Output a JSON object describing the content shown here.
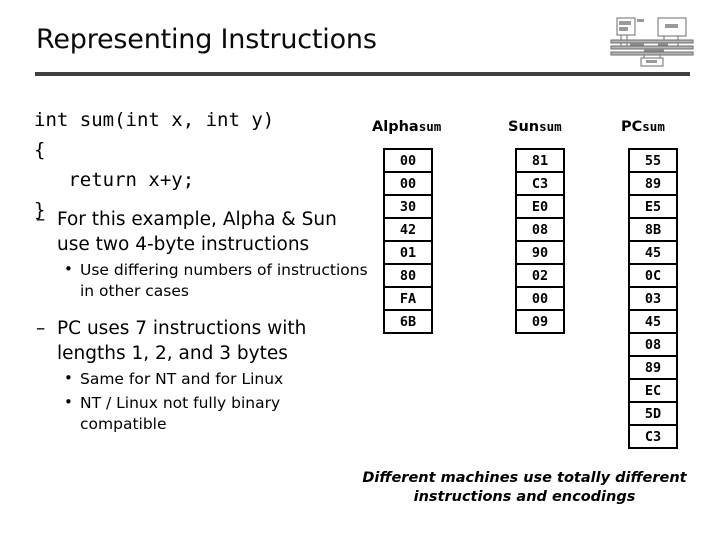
{
  "slide": {
    "title": "Representing Instructions",
    "logo_name": "system-block-diagram-logo"
  },
  "code": {
    "text": "int sum(int x, int y)\n{\n   return x+y;\n}"
  },
  "bullets": [
    {
      "marker": "–",
      "text": "For this example, Alpha & Sun use two 4-byte instructions",
      "children": [
        {
          "marker": "•",
          "text": "Use differing numbers of instructions in other cases"
        }
      ]
    },
    {
      "marker": "–",
      "text": "PC uses 7 instructions with lengths 1, 2, and 3 bytes",
      "children": [
        {
          "marker": "•",
          "text": "Same for NT and for Linux"
        },
        {
          "marker": "•",
          "text": "NT / Linux not fully binary compatible"
        }
      ]
    }
  ],
  "tables": {
    "columns": [
      {
        "id": "alpha",
        "head_name": "Alpha",
        "head_symbol": "sum",
        "bytes": [
          "00",
          "00",
          "30",
          "42",
          "01",
          "80",
          "FA",
          "6B"
        ]
      },
      {
        "id": "sun",
        "head_name": "Sun",
        "head_symbol": "sum",
        "bytes": [
          "81",
          "C3",
          "E0",
          "08",
          "90",
          "02",
          "00",
          "09"
        ]
      },
      {
        "id": "pc",
        "head_name": "PC",
        "head_symbol": "sum",
        "bytes": [
          "55",
          "89",
          "E5",
          "8B",
          "45",
          "0C",
          "03",
          "45",
          "08",
          "89",
          "EC",
          "5D",
          "C3"
        ]
      }
    ]
  },
  "caption": {
    "line1": "Different machines use totally different",
    "line2": "instructions and encodings"
  },
  "colors": {
    "text": "#000000",
    "rule": "#3f3f3f",
    "background": "#ffffff"
  }
}
